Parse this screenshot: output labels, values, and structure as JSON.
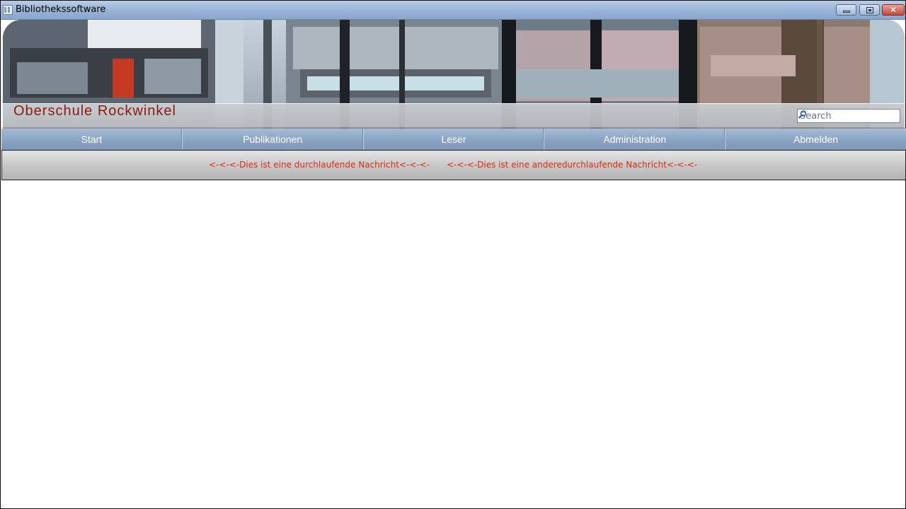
{
  "window": {
    "title": "Bibliothekssoftware",
    "icon": "app-window-icon",
    "controls": [
      "minimize-icon",
      "maximize-icon",
      "close-icon"
    ]
  },
  "header": {
    "school_name": "Oberschule Rockwinkel",
    "search": {
      "placeholder": "Search",
      "value": ""
    }
  },
  "nav": {
    "items": [
      "Start",
      "Publikationen",
      "Leser",
      "Administration",
      "Abmelden"
    ]
  },
  "ticker": {
    "messages": [
      "<-<-<-Dies ist eine durchlaufende Nachricht<-<-<-",
      "<-<-<-Dies ist eine anderedurchlaufende Nachricht<-<-<-"
    ]
  },
  "colors": {
    "titlebar": "#9ab4d6",
    "nav": "#8aa3c4",
    "school_name": "#8c1a10",
    "ticker_text": "#e02a14"
  }
}
